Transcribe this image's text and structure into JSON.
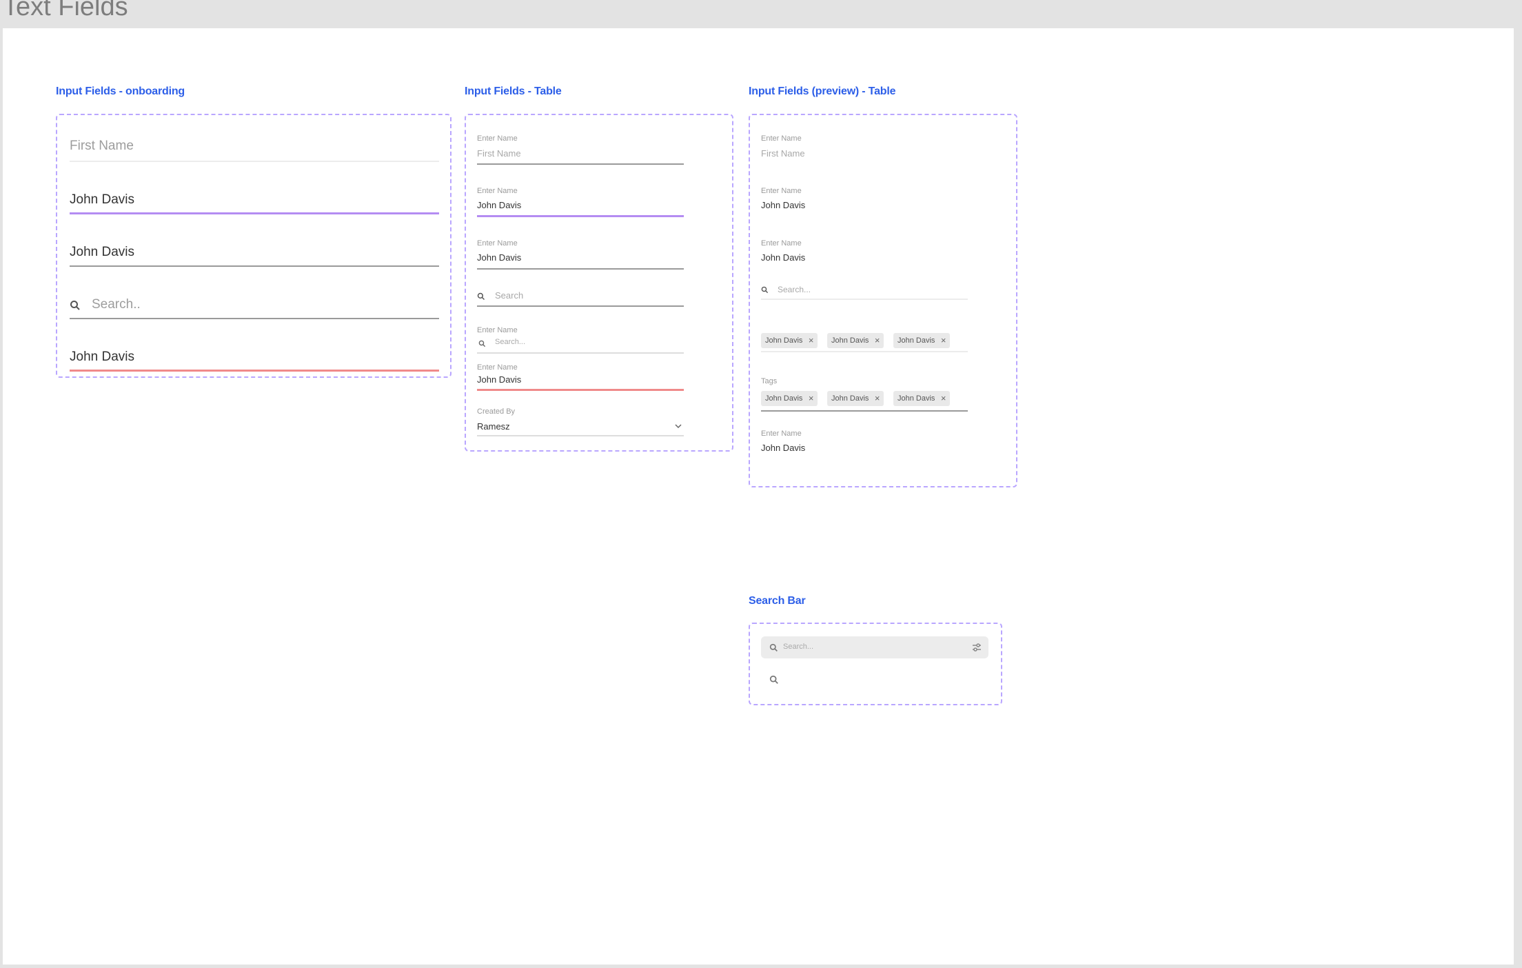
{
  "page": {
    "title": "Text Fields"
  },
  "sections": {
    "onboarding": {
      "title": "Input Fields - onboarding",
      "fields": [
        {
          "placeholder": "First Name"
        },
        {
          "value": "John Davis"
        },
        {
          "value": "John Davis"
        },
        {
          "placeholder": "Search.."
        },
        {
          "value": "John Davis"
        }
      ]
    },
    "table": {
      "title": "Input Fields - Table",
      "fields": [
        {
          "label": "Enter Name",
          "placeholder": "First Name"
        },
        {
          "label": "Enter Name",
          "value": "John Davis"
        },
        {
          "label": "Enter Name",
          "value": "John Davis"
        },
        {
          "placeholder": "Search"
        },
        {
          "label": "Enter Name",
          "placeholder": "Search..."
        },
        {
          "label": "Enter Name",
          "value": "John Davis"
        },
        {
          "label": "Created By",
          "value": "Ramesz"
        }
      ]
    },
    "preview": {
      "title": "Input Fields (preview) - Table",
      "fields": [
        {
          "label": "Enter Name",
          "placeholder": "First Name"
        },
        {
          "label": "Enter Name",
          "value": "John Davis"
        },
        {
          "label": "Enter Name",
          "value": "John Davis"
        },
        {
          "placeholder": "Search..."
        },
        {
          "chips": [
            "John Davis",
            "John Davis",
            "John Davis"
          ]
        },
        {
          "label": "Tags",
          "chips": [
            "John Davis",
            "John Davis",
            "John Davis"
          ]
        },
        {
          "label": "Enter Name",
          "value": "John Davis"
        }
      ]
    },
    "searchbar": {
      "title": "Search Bar",
      "placeholder": "Search..."
    }
  },
  "colors": {
    "accent_title": "#2c5ee8",
    "frame_border": "#b9a6ff",
    "focus_underline": "#b48cf2",
    "error_underline": "#f08a8a"
  },
  "icons": {
    "search": "search-icon",
    "chip_close": "close-icon",
    "dropdown": "chevron-down-icon",
    "filter": "filter-icon"
  }
}
